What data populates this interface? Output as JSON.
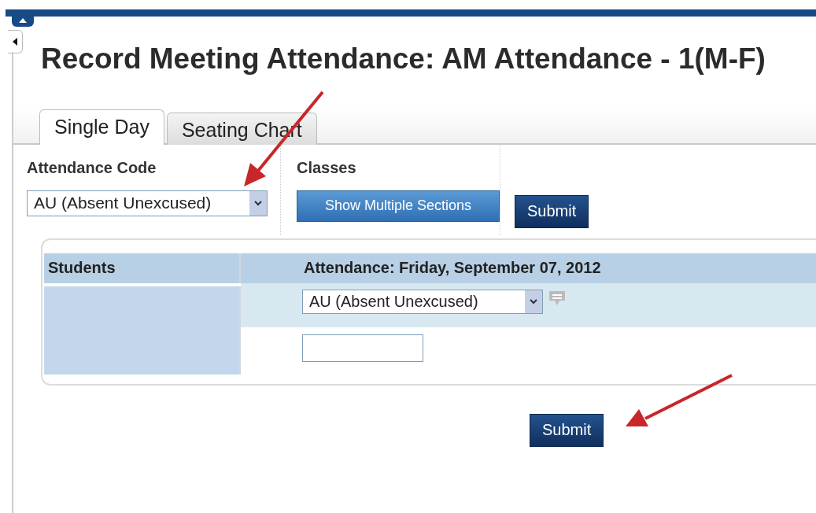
{
  "title": "Record Meeting Attendance: AM Attendance - 1(M-F)",
  "tabs": [
    {
      "label": "Single Day",
      "selected": true
    },
    {
      "label": "Seating Chart",
      "selected": false
    }
  ],
  "toolbar": {
    "code_label": "Attendance Code",
    "code_value": "AU (Absent Unexcused)",
    "classes_label": "Classes",
    "sections_button": "Show Multiple Sections",
    "submit_button": "Submit"
  },
  "table": {
    "columns": [
      "Students",
      "Attendance: Friday, September 07, 2012"
    ],
    "row": {
      "code_value": "AU (Absent Unexcused)"
    }
  },
  "submit_button": "Submit"
}
